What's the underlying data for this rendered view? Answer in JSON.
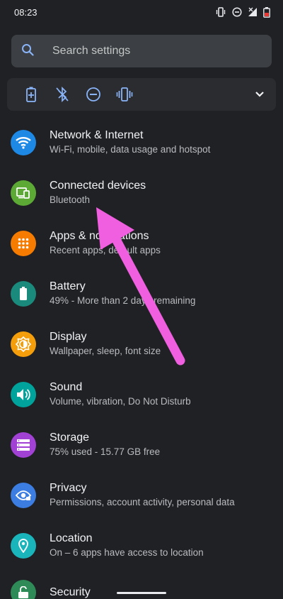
{
  "status_bar": {
    "time": "08:23",
    "icons": [
      "vibrate-icon",
      "dnd-icon",
      "signal-icon",
      "battery-icon"
    ]
  },
  "search": {
    "placeholder": "Search settings"
  },
  "quick_settings": {
    "icons": [
      "battery-saver-icon",
      "bluetooth-off-icon",
      "dnd-icon",
      "vibrate-icon"
    ],
    "expand_icon": "chevron-down-icon"
  },
  "settings": [
    {
      "title": "Network & Internet",
      "subtitle": "Wi-Fi, mobile, data usage and hotspot",
      "icon": "wifi-icon",
      "color": "#1e88e5"
    },
    {
      "title": "Connected devices",
      "subtitle": "Bluetooth",
      "icon": "devices-icon",
      "color": "#5da935"
    },
    {
      "title": "Apps & notifications",
      "subtitle": "Recent apps, default apps",
      "icon": "apps-icon",
      "color": "#f57c00"
    },
    {
      "title": "Battery",
      "subtitle": "49% - More than 2 days remaining",
      "icon": "battery-icon",
      "color": "#1a8a7d"
    },
    {
      "title": "Display",
      "subtitle": "Wallpaper, sleep, font size",
      "icon": "brightness-icon",
      "color": "#f59e0b"
    },
    {
      "title": "Sound",
      "subtitle": "Volume, vibration, Do Not Disturb",
      "icon": "volume-icon",
      "color": "#00a39b"
    },
    {
      "title": "Storage",
      "subtitle": "75% used - 15.77 GB free",
      "icon": "storage-icon",
      "color": "#a142d4"
    },
    {
      "title": "Privacy",
      "subtitle": "Permissions, account activity, personal data",
      "icon": "eye-icon",
      "color": "#3b7de0"
    },
    {
      "title": "Location",
      "subtitle": "On – 6 apps have access to location",
      "icon": "location-icon",
      "color": "#1ab4bb"
    },
    {
      "title": "Security",
      "subtitle": "",
      "icon": "lock-icon",
      "color": "#2e8b57"
    }
  ],
  "annotation": {
    "color": "#f05fe0"
  }
}
